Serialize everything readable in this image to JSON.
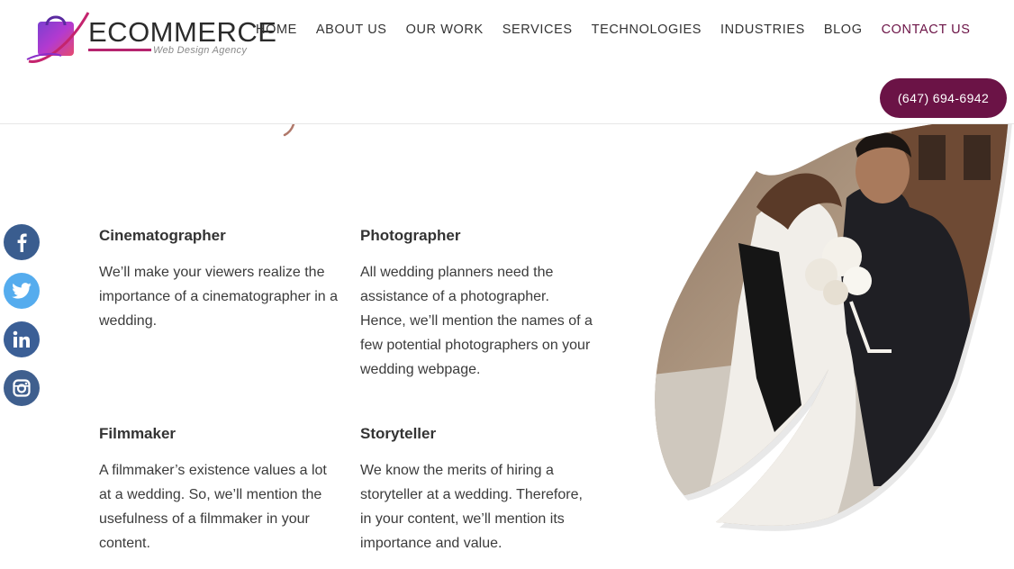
{
  "brand": {
    "name": "ECOMMERCE",
    "tagline": "Web Design Agency"
  },
  "nav": {
    "items": [
      {
        "label": "HOME"
      },
      {
        "label": "ABOUT US"
      },
      {
        "label": "OUR WORK"
      },
      {
        "label": "SERVICES"
      },
      {
        "label": "TECHNOLOGIES"
      },
      {
        "label": "INDUSTRIES"
      },
      {
        "label": "BLOG"
      },
      {
        "label": "CONTACT US",
        "active": true
      }
    ]
  },
  "header": {
    "phone_label": "(647) 694-6942"
  },
  "social": [
    "facebook-icon",
    "twitter-icon",
    "linkedin-icon",
    "instagram-icon"
  ],
  "colors": {
    "accent": "#6b1346",
    "facebook": "#3a5d8f",
    "twitter": "#55acee"
  },
  "blocks": [
    {
      "title": "Cinematographer",
      "text": "We’ll make your viewers realize the importance of a cinematographer in a wedding."
    },
    {
      "title": "Photographer",
      "text": "All wedding planners need the assistance of a photographer. Hence, we’ll mention the names of a few potential photographers on your wedding webpage."
    },
    {
      "title": "Filmmaker",
      "text": "A filmmaker’s existence values a lot at a wedding. So, we’ll mention the usefulness of a filmmaker in your content."
    },
    {
      "title": "Storyteller",
      "text": "We know the merits of hiring a storyteller at a wedding. Therefore, in your content, we’ll mention its importance and value."
    }
  ]
}
